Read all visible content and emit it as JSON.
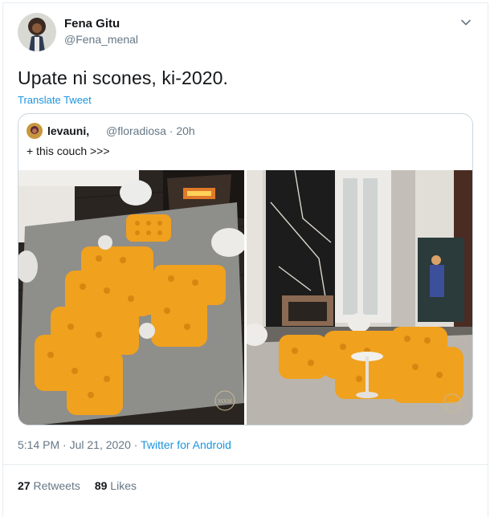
{
  "tweet": {
    "author_name": "Fena Gitu",
    "author_handle": "@Fena_menal",
    "text": "Upate ni scones, ki-2020.",
    "translate_label": "Translate Tweet",
    "timestamp": "5:14 PM · Jul 21, 2020",
    "separator": " · ",
    "source": "Twitter for Android",
    "retweet_count": "27",
    "retweet_label": "Retweets",
    "like_count": "89",
    "like_label": "Likes"
  },
  "quote": {
    "author_name": "levauni,",
    "author_handle": "@floradiosa",
    "time": " · 20h",
    "text": "+ this couch >>>"
  },
  "icons": {
    "menu": "chevron-down-icon",
    "avatar": "avatar",
    "watermark": "maxmillion-logo-icon"
  },
  "colors": {
    "link": "#1b95e0",
    "text": "#14171a",
    "secondary": "#657786",
    "border": "#ccd6dd",
    "sofa": "#f0a11e"
  }
}
